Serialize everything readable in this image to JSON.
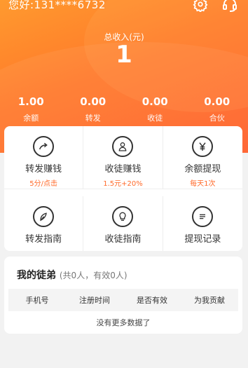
{
  "header": {
    "greeting": "您好:131****6732",
    "total_label": "总收入(元)",
    "total_value": "1",
    "icons": {
      "settings": "gear-icon",
      "service": "customer-service-icon"
    }
  },
  "stats": [
    {
      "value": "1.00",
      "label": "余额"
    },
    {
      "value": "0.00",
      "label": "转发"
    },
    {
      "value": "0.00",
      "label": "收徒"
    },
    {
      "value": "0.00",
      "label": "合伙"
    }
  ],
  "features": [
    {
      "title": "转发赚钱",
      "sub": "5分/点击",
      "icon": "share-icon"
    },
    {
      "title": "收徒赚钱",
      "sub": "1.5元+20%",
      "icon": "people-icon"
    },
    {
      "title": "余额提现",
      "sub": "每天1次",
      "icon": "yen-icon"
    },
    {
      "title": "转发指南",
      "sub": "",
      "icon": "feather-icon"
    },
    {
      "title": "收徒指南",
      "sub": "",
      "icon": "lightbulb-icon"
    },
    {
      "title": "提现记录",
      "sub": "",
      "icon": "record-icon"
    }
  ],
  "team": {
    "title": "我的徒弟",
    "subtitle": "(共0人，有效0人)",
    "columns": [
      "手机号",
      "注册时间",
      "是否有效",
      "为我贡献"
    ],
    "empty_text": "没有更多数据了"
  },
  "colors": {
    "accent": "#ff6a2a",
    "header_start": "#ff9a2e",
    "header_end": "#ff5e2a"
  }
}
